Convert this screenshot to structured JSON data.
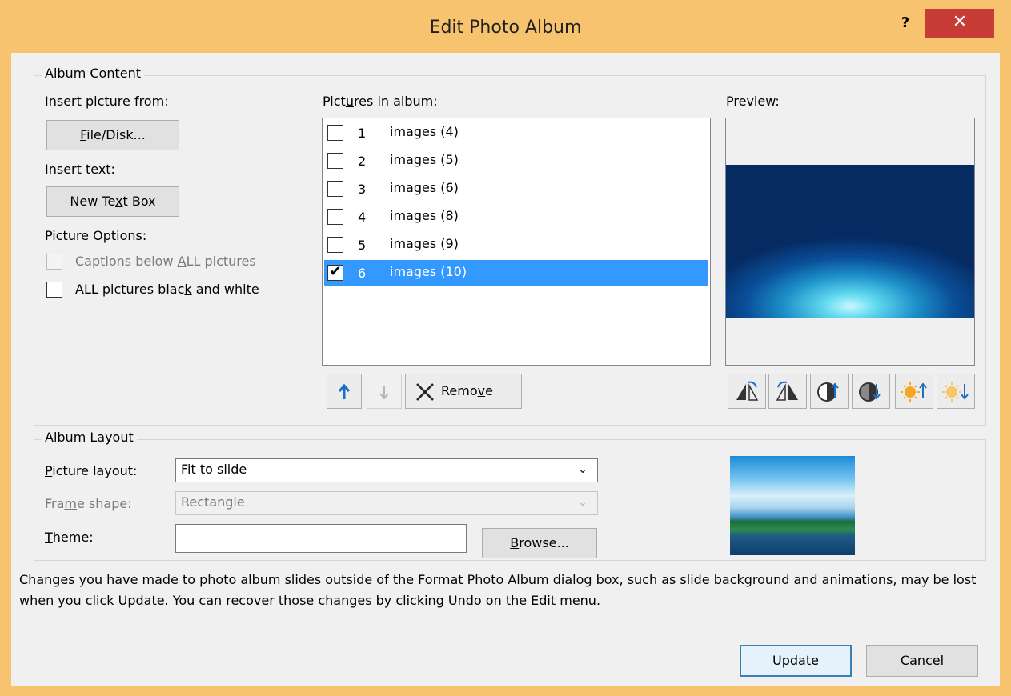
{
  "window": {
    "title": "Edit Photo Album",
    "help_label": "?",
    "close_label": "✕"
  },
  "album_content": {
    "group_label": "Album Content",
    "insert_picture_from_label": "Insert picture from:",
    "file_disk_button": {
      "pre": "",
      "u": "F",
      "post": "ile/Disk..."
    },
    "insert_text_label": "Insert text:",
    "new_text_box_button": {
      "pre": "New Te",
      "u": "x",
      "post": "t Box"
    },
    "picture_options_label": "Picture Options:",
    "captions_option": {
      "pre": "Captions below ",
      "u": "A",
      "post": "LL pictures",
      "checked": false,
      "enabled": false
    },
    "black_white_option": {
      "pre": "ALL pictures blac",
      "u": "k",
      "post": " and white",
      "checked": false,
      "enabled": true
    },
    "pictures_label": {
      "pre": "Pict",
      "u": "u",
      "post": "res in album:"
    },
    "pictures": [
      {
        "num": "1",
        "name": "images (4)",
        "checked": false,
        "selected": false
      },
      {
        "num": "2",
        "name": "images (5)",
        "checked": false,
        "selected": false
      },
      {
        "num": "3",
        "name": "images (6)",
        "checked": false,
        "selected": false
      },
      {
        "num": "4",
        "name": "images (8)",
        "checked": false,
        "selected": false
      },
      {
        "num": "5",
        "name": "images (9)",
        "checked": false,
        "selected": false
      },
      {
        "num": "6",
        "name": "images (10)",
        "checked": true,
        "selected": true
      }
    ],
    "remove_button": {
      "pre": "Remo",
      "u": "v",
      "post": "e"
    },
    "preview_label": "Preview:",
    "check_mark": "✔"
  },
  "album_layout": {
    "group_label": "Album Layout",
    "picture_layout_label": {
      "pre": "",
      "u": "P",
      "post": "icture layout:"
    },
    "picture_layout_value": "Fit to slide",
    "frame_shape_label": {
      "pre": "Fra",
      "u": "m",
      "post": "e shape:"
    },
    "frame_shape_value": "Rectangle",
    "theme_label": {
      "pre": "",
      "u": "T",
      "post": "heme:"
    },
    "theme_value": "",
    "browse_button": {
      "pre": "",
      "u": "B",
      "post": "rowse..."
    }
  },
  "note_text": "Changes you have made to photo album slides outside of the Format Photo Album dialog box, such as slide background and animations, may be lost when you click Update. You can recover those changes by clicking Undo on the Edit menu.",
  "footer": {
    "update_button": {
      "pre": "",
      "u": "U",
      "post": "pdate"
    },
    "cancel_button": "Cancel"
  },
  "colors": {
    "title_bar": "#f7c36f",
    "close_button": "#c73c34",
    "selection": "#3399ff",
    "arrow_enabled": "#1e6ec8"
  }
}
